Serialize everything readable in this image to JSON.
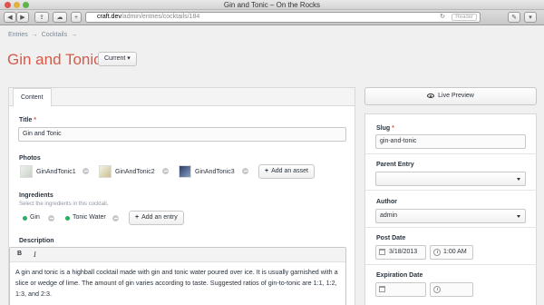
{
  "window": {
    "title": "Gin and Tonic – On the Rocks"
  },
  "toolbar": {
    "url_host": "craft.dev",
    "url_path": "/admin/entries/cocktails/184",
    "reader_label": "Reader",
    "reload_glyph": "↻",
    "plus_glyph": "+",
    "back_glyph": "◀",
    "forward_glyph": "▶",
    "share_glyph": "⇪",
    "cloud_glyph": "☁",
    "wrench_glyph": "✎",
    "dropdown_glyph": "▾"
  },
  "breadcrumb": {
    "items": [
      "Entries",
      "→",
      "Cocktails",
      "→"
    ]
  },
  "page": {
    "title": "Gin and Tonic",
    "revision_label": "Current ▾"
  },
  "tabs": [
    {
      "label": "Content"
    }
  ],
  "fields": {
    "title": {
      "label": "Title",
      "required": "*",
      "value": "Gin and Tonic"
    },
    "photos": {
      "label": "Photos",
      "assets": [
        "GinAndTonic1",
        "GinAndTonic2",
        "GinAndTonic3"
      ],
      "add_label": "Add an asset",
      "add_glyph": "+"
    },
    "ingredients": {
      "label": "Ingredients",
      "instructions": "Select the ingredients in this cocktail.",
      "entries": [
        "Gin",
        "Tonic Water"
      ],
      "add_label": "Add an entry",
      "add_glyph": "+"
    },
    "description": {
      "label": "Description",
      "bold_label": "B",
      "italic_label": "I",
      "body": "A gin and tonic is a highball cocktail made with gin and tonic water poured over ice. It is usually garnished with a slice or wedge of lime. The amount of gin varies according to taste. Suggested ratios of gin-to-tonic are 1:1, 1:2, 1:3, and 2:3."
    }
  },
  "sidebar": {
    "live_preview_label": "Live Preview",
    "slug": {
      "label": "Slug",
      "required": "*",
      "value": "gin-and-tonic"
    },
    "parent_entry": {
      "label": "Parent Entry",
      "value": ""
    },
    "author": {
      "label": "Author",
      "value": "admin"
    },
    "post_date": {
      "label": "Post Date",
      "date": "3/18/2013",
      "time": "1:00 AM"
    },
    "expiration_date": {
      "label": "Expiration Date",
      "date": "",
      "time": ""
    }
  },
  "colors": {
    "accent": "#d65a47",
    "status_enabled": "#27ae60"
  }
}
